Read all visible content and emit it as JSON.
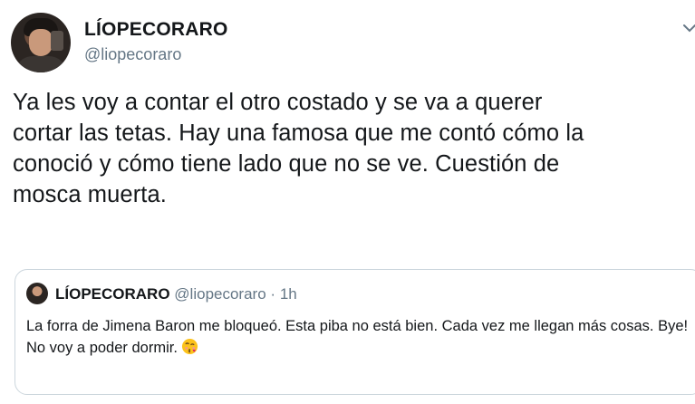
{
  "tweet": {
    "author_name": "LÍOPECORARO",
    "author_handle": "@liopecoraro",
    "text": "Ya les voy a contar el otro costado y se va a querer\ncortar las tetas. Hay una famosa que me contó cómo la\nconoció y cómo tiene lado que no se ve. Cuestión de\nmosca muerta.",
    "menu_icon": "chevron-down-icon"
  },
  "quoted_tweet": {
    "author_name": "LÍOPECORARO",
    "author_handle": "@liopecoraro",
    "separator": "·",
    "time": "1h",
    "text_line1": "La forra de Jimena Baron me bloqueó. Esta piba no está bien. Cada vez me llegan más cosas. Bye!",
    "text_line2": "No voy a poder dormir.",
    "emoji": "kissing-face-emoji"
  },
  "colors": {
    "text": "#14171a",
    "secondary": "#657786",
    "border": "#ccd6dd"
  }
}
